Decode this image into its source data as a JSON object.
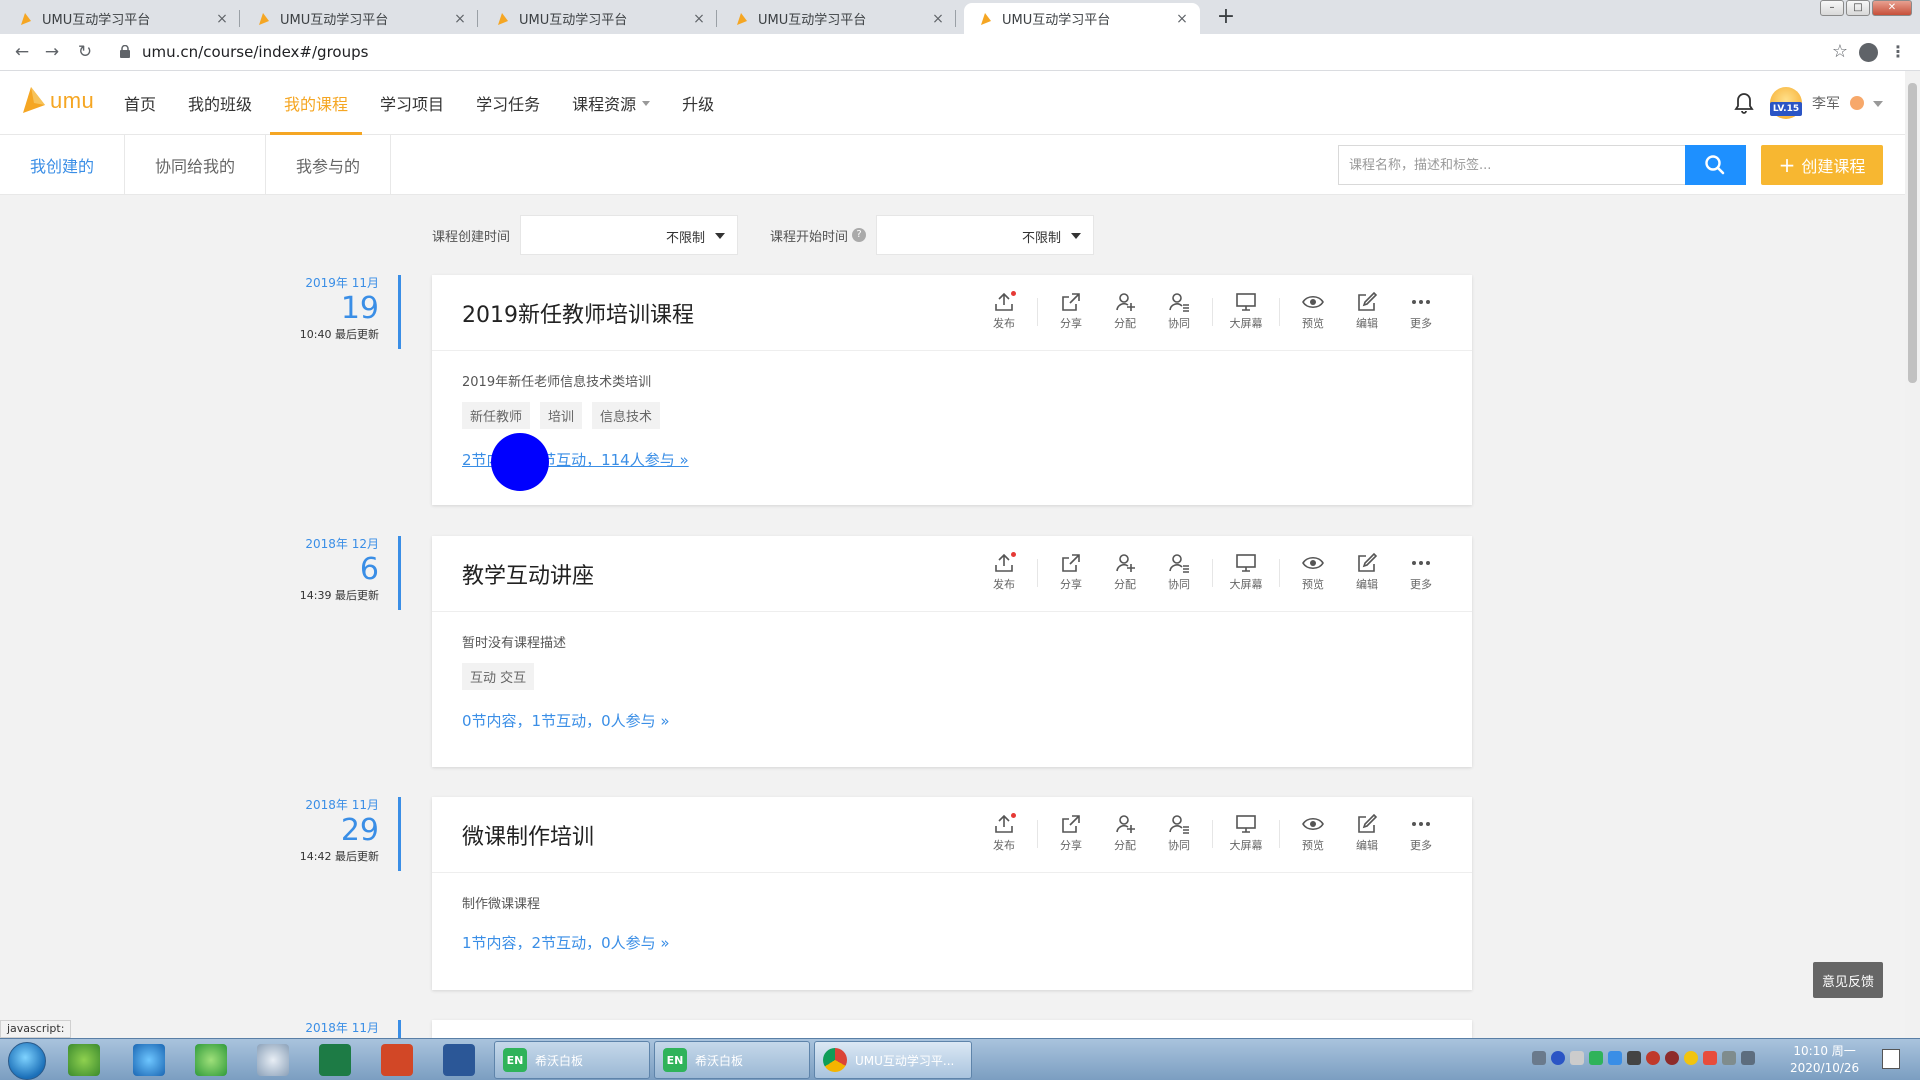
{
  "browser": {
    "tabs": [
      {
        "title": "UMU互动学习平台",
        "active": false
      },
      {
        "title": "UMU互动学习平台",
        "active": false
      },
      {
        "title": "UMU互动学习平台",
        "active": false
      },
      {
        "title": "UMU互动学习平台",
        "active": false
      },
      {
        "title": "UMU互动学习平台",
        "active": true
      }
    ],
    "new_tab_label": "+",
    "url": "umu.cn/course/index#/groups",
    "status_text": "javascript:"
  },
  "header": {
    "logo_text": "umu",
    "nav": [
      {
        "label": "首页"
      },
      {
        "label": "我的班级"
      },
      {
        "label": "我的课程",
        "active": true
      },
      {
        "label": "学习项目"
      },
      {
        "label": "学习任务"
      },
      {
        "label": "课程资源",
        "has_dropdown": true
      },
      {
        "label": "升级"
      }
    ],
    "user": {
      "name": "李军",
      "level": "LV.15"
    }
  },
  "subheader": {
    "tabs": [
      {
        "label": "我创建的",
        "active": true
      },
      {
        "label": "协同给我的"
      },
      {
        "label": "我参与的"
      }
    ],
    "search_placeholder": "课程名称，描述和标签...",
    "create_label": "创建课程"
  },
  "filters": {
    "created_label": "课程创建时间",
    "created_value": "不限制",
    "start_label": "课程开始时间",
    "start_value": "不限制",
    "help_glyph": "?"
  },
  "actions": [
    {
      "label": "发布",
      "icon": "publish-icon"
    },
    {
      "label": "分享",
      "icon": "share-icon"
    },
    {
      "label": "分配",
      "icon": "assign-icon"
    },
    {
      "label": "协同",
      "icon": "collaborate-icon"
    },
    {
      "label": "大屏幕",
      "icon": "big-screen-icon"
    },
    {
      "label": "预览",
      "icon": "preview-icon"
    },
    {
      "label": "编辑",
      "icon": "edit-icon"
    },
    {
      "label": "更多",
      "icon": "more-icon"
    }
  ],
  "courses": [
    {
      "date_ym": "2019年 11月",
      "date_day": "19",
      "updated": "10:40 最后更新",
      "title": "2019新任教师培训课程",
      "description": "2019年新任老师信息技术类培训",
      "tags": [
        "新任教师",
        "培训",
        "信息技术"
      ],
      "stats": "2节内容，2节互动，114人参与 »"
    },
    {
      "date_ym": "2018年 12月",
      "date_day": "6",
      "updated": "14:39 最后更新",
      "title": "教学互动讲座",
      "description": "暂时没有课程描述",
      "tags": [
        "互动 交互"
      ],
      "stats": "0节内容，1节互动，0人参与 »"
    },
    {
      "date_ym": "2018年 11月",
      "date_day": "29",
      "updated": "14:42 最后更新",
      "title": "微课制作培训",
      "description": "制作微课课程",
      "tags": [],
      "stats": "1节内容，2节互动，0人参与 »"
    },
    {
      "date_ym": "2018年 11月",
      "date_day": "",
      "updated": "",
      "title": "",
      "description": "",
      "tags": [],
      "stats": ""
    }
  ],
  "feedback_label": "意见反馈",
  "taskbar": {
    "tasks": [
      {
        "label": "希沃白板",
        "icon_text": "EN"
      },
      {
        "label": "希沃白板",
        "icon_text": "EN"
      },
      {
        "label": "UMU互动学习平...",
        "icon_text": ""
      }
    ],
    "clock_time": "10:10 周一",
    "clock_date": "2020/10/26"
  },
  "colors": {
    "brand": "#f5a623",
    "link": "#3a8ee6",
    "search_button": "#1e90ff",
    "create_button": "#f7b731"
  }
}
